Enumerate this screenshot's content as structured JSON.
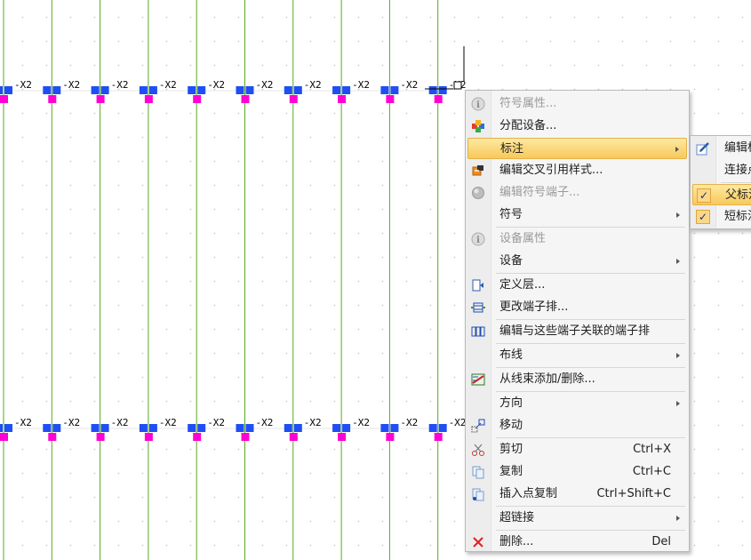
{
  "canvas": {
    "column_count": 10,
    "terminal_label": "-X2"
  },
  "context_menu": {
    "items": [
      {
        "label": "符号属性...",
        "icon": "info-icon",
        "disabled": true
      },
      {
        "label": "分配设备...",
        "icon": "assign-device-icon"
      },
      {
        "label": "标注",
        "icon": "",
        "submenu": true,
        "highlighted": true
      },
      {
        "label": "编辑交叉引用样式...",
        "icon": "cross-reference-icon"
      },
      {
        "label": "编辑符号端子...",
        "icon": "symbol-terminal-icon",
        "disabled": true
      },
      {
        "label": "符号",
        "icon": "",
        "submenu": true
      },
      {
        "label": "设备属性",
        "icon": "info-icon",
        "disabled": true
      },
      {
        "label": "设备",
        "icon": "",
        "submenu": true
      },
      {
        "label": "定义层...",
        "icon": "define-layer-icon"
      },
      {
        "label": "更改端子排...",
        "icon": "change-terminal-strip-icon"
      },
      {
        "label": "编辑与这些端子关联的端子排",
        "icon": "terminal-strip-icon"
      },
      {
        "label": "布线",
        "icon": "",
        "submenu": true
      },
      {
        "label": "从线束添加/删除...",
        "icon": "harness-icon"
      },
      {
        "label": "方向",
        "icon": "",
        "submenu": true
      },
      {
        "label": "移动",
        "icon": "move-icon"
      },
      {
        "label": "剪切",
        "icon": "scissors-icon",
        "shortcut": "Ctrl+X"
      },
      {
        "label": "复制",
        "icon": "copy-icon",
        "shortcut": "Ctrl+C"
      },
      {
        "label": "插入点复制",
        "icon": "insert-point-copy-icon",
        "shortcut": "Ctrl+Shift+C"
      },
      {
        "label": "超链接",
        "icon": "",
        "submenu": true
      },
      {
        "label": "删除...",
        "icon": "delete-x-icon",
        "shortcut": "Del"
      }
    ]
  },
  "submenu": {
    "items": [
      {
        "label": "编辑标",
        "icon": "edit-annotation-icon"
      },
      {
        "label": "连接点",
        "icon": ""
      },
      {
        "label": "父标注",
        "icon": "checkbox-checked-icon",
        "checked": true,
        "highlighted": true
      },
      {
        "label": "短标注",
        "icon": "checkbox-checked-icon",
        "checked": true
      }
    ],
    "check_mark": "✓"
  },
  "colors": {
    "wire": "#5aa81e",
    "terminal_blue": "#1f4ef5",
    "terminal_magenta": "#ff00d4",
    "highlight": "#f8c95a"
  }
}
